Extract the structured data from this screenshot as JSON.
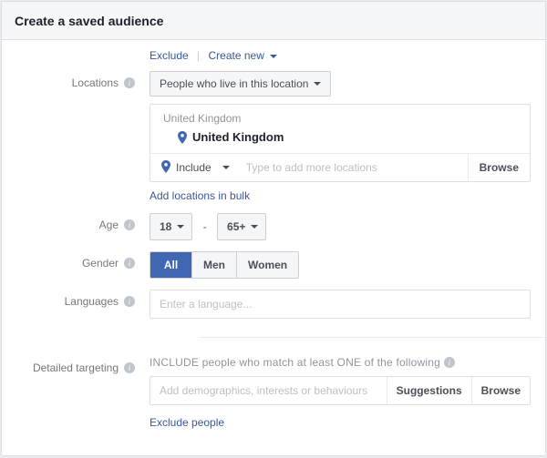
{
  "header": {
    "title": "Create a saved audience"
  },
  "top_links": {
    "exclude": "Exclude",
    "create_new": "Create new"
  },
  "labels": {
    "locations": "Locations",
    "age": "Age",
    "gender": "Gender",
    "languages": "Languages",
    "detailed_targeting": "Detailed targeting"
  },
  "locations": {
    "scope_selected": "People who live in this location",
    "region_heading": "United Kingdom",
    "country_name": "United Kingdom",
    "include_label": "Include",
    "input_placeholder": "Type to add more locations",
    "browse_label": "Browse",
    "bulk_link": "Add locations in bulk"
  },
  "age": {
    "min": "18",
    "max": "65+"
  },
  "gender": {
    "options": {
      "all": "All",
      "men": "Men",
      "women": "Women"
    },
    "selected": "all"
  },
  "languages": {
    "placeholder": "Enter a language..."
  },
  "detailed_targeting": {
    "heading": "INCLUDE people who match at least ONE of the following",
    "input_placeholder": "Add demographics, interests or behaviours",
    "suggestions_label": "Suggestions",
    "browse_label": "Browse",
    "exclude_link": "Exclude people"
  }
}
